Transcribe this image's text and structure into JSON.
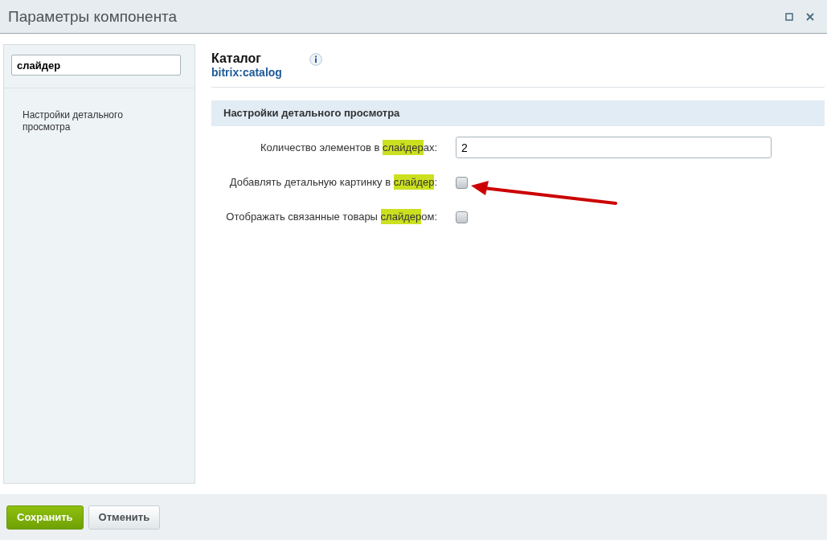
{
  "window": {
    "title": "Параметры компонента"
  },
  "sidebar": {
    "search": {
      "value": "слайдер"
    },
    "items": [
      {
        "label": "Настройки детального просмотра",
        "selected": false
      }
    ]
  },
  "component": {
    "name": "Каталог",
    "code": "bitrix:catalog"
  },
  "section": {
    "title": "Настройки детального просмотра"
  },
  "fields": [
    {
      "kind": "text",
      "label": [
        {
          "text": "Количество элементов в ",
          "highlight": false
        },
        {
          "text": "слайдер",
          "highlight": true
        },
        {
          "text": "ах:",
          "highlight": false
        }
      ],
      "value": "2"
    },
    {
      "kind": "checkbox",
      "label": [
        {
          "text": "Добавлять детальную картинку в ",
          "highlight": false
        },
        {
          "text": "слайдер",
          "highlight": true
        },
        {
          "text": ":",
          "highlight": false
        }
      ],
      "checked": false
    },
    {
      "kind": "checkbox",
      "label": [
        {
          "text": "Отображать связанные товары ",
          "highlight": false
        },
        {
          "text": "слайдер",
          "highlight": true
        },
        {
          "text": "ом:",
          "highlight": false
        }
      ],
      "checked": false
    }
  ],
  "buttons": [
    {
      "label": "Сохранить",
      "kind": "primary"
    },
    {
      "label": "Отменить",
      "kind": "secondary"
    }
  ]
}
